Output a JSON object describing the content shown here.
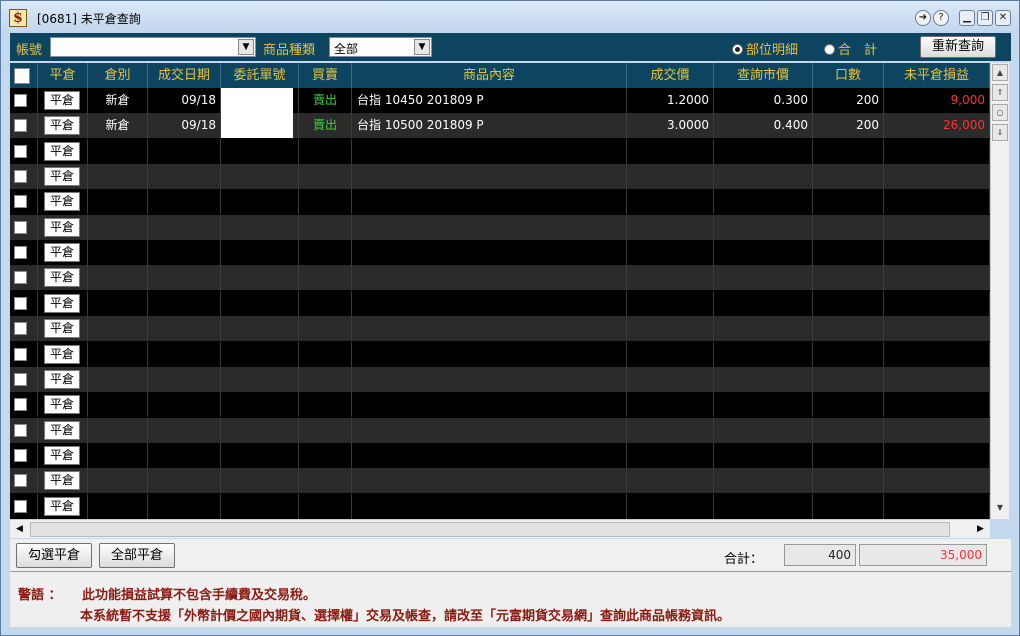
{
  "window": {
    "title": "[0681] 未平倉查詢",
    "icon_glyph": "$",
    "controls": [
      "exit-icon",
      "help-icon",
      "minimize-icon",
      "restore-icon",
      "close-icon"
    ]
  },
  "toolbar": {
    "account_label": "帳號",
    "account_value": "",
    "category_label": "商品種類",
    "category_value": "全部",
    "radio_detail": "部位明細",
    "radio_total": "合　計",
    "requery_button": "重新查詢"
  },
  "grid": {
    "headers": [
      "平倉",
      "倉別",
      "成交日期",
      "委託單號",
      "買賣",
      "商品內容",
      "成交價",
      "查詢市價",
      "口數",
      "未平倉損益"
    ],
    "close_button_label": "平倉",
    "rows": [
      {
        "kind": "新倉",
        "date": "09/18",
        "order": "",
        "side": "賣出",
        "product": "台指 10450 201809 P",
        "price": "1.2000",
        "market": "0.300",
        "qty": "200",
        "pnl": "9,000"
      },
      {
        "kind": "新倉",
        "date": "09/18",
        "order": "",
        "side": "賣出",
        "product": "台指 10500 201809 P",
        "price": "3.0000",
        "market": "0.400",
        "qty": "200",
        "pnl": "26,000"
      }
    ],
    "empty_rows": 15
  },
  "bottom": {
    "close_selected": "勾選平倉",
    "close_all": "全部平倉",
    "total_label": "合計：",
    "total_qty": "400",
    "total_pnl": "35,000"
  },
  "warning": {
    "label": "警語 ：",
    "line1": "此功能損益試算不包含手續費及交易稅。",
    "line2": "本系統暫不支援「外幣計價之國內期貨、選擇權」交易及帳查，請改至「元富期貨交易網」查詢此商品帳務資訊。"
  },
  "colors": {
    "header_bg": "#0d4560",
    "header_text": "#e8c23a",
    "buy_sell": "#3cd23c",
    "pnl": "#ff3030"
  }
}
